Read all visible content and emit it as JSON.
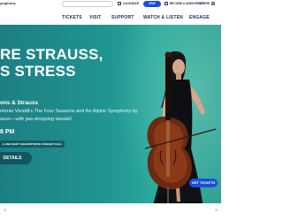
{
  "brand": {
    "name": "ymphony"
  },
  "utility": {
    "search_placeholder": "",
    "calendar_label": "CALENDAR",
    "give_label": "GIVE",
    "subscriber_label": "BECOME A SUBSCRIBER",
    "store_label": "STORE"
  },
  "nav": {
    "items": [
      "TICKETS",
      "VISIT",
      "SUPPORT",
      "WATCH & LISTEN",
      "ENGAGE"
    ]
  },
  "hero": {
    "title_line1": "RE STRAUSS,",
    "title_line2": "S STRESS",
    "subtitle": "ons & Strauss",
    "desc_line1": "ntonio Vivaldi's The Four Seasons and An Alpine Symphony by",
    "desc_line2": "auss—with jaw-dropping visuals!",
    "time": "8 PM",
    "venue_tag": "E AND MARY SEGERSTROM CONCERT HALL",
    "details_label": "DETAILS",
    "get_tickets_label": "GET TICKETS"
  },
  "colors": {
    "hero_teal": "#1f938f",
    "accent_blue": "#1b4fd8",
    "nav_text": "#1f2a44"
  }
}
